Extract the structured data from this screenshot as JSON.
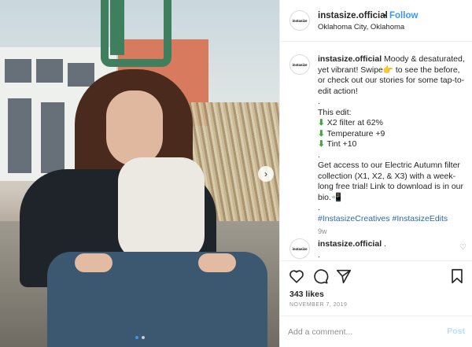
{
  "post": {
    "avatar_text": "instasize",
    "username": "instasize.official",
    "separator": "•",
    "follow_label": "Follow",
    "location": "Oklahoma City, Oklahoma"
  },
  "caption": {
    "username": "instasize.official",
    "text_1": " Moody & desaturated, yet vibrant! Swipe",
    "swipe_emoji": "👉",
    "text_2": " to see the before, or check out our stories for some tap-to-edit action!",
    "dot_1": ".",
    "edit_heading": "This edit:",
    "arrow_icon": "⬇",
    "line_filter": "X2 filter at 62%",
    "line_temp": "Temperature +9",
    "line_tint": "Tint +10",
    "dot_2": ".",
    "access_text": "Get access to our Electric Autumn filter collection (X1, X2, & X3) with a week-long free trial! Link to download is in our bio.",
    "phone_emoji": "📲",
    "dot_3": ".",
    "hashtags": "#InstasizeCreatives #InstasizeEdits",
    "time_ago": "9w"
  },
  "second_comment": {
    "username": "instasize.official",
    "text": ".",
    "dot": ".",
    "heart_icon": "♡"
  },
  "actions": {
    "icons": [
      "heart-icon",
      "comment-icon",
      "share-icon",
      "bookmark-icon"
    ]
  },
  "likes_text": "343 likes",
  "date_text": "NOVEMBER 7, 2019",
  "add_comment": {
    "placeholder": "Add a comment...",
    "post_label": "Post"
  },
  "carousel": {
    "next_icon": "›",
    "active_dot": 0,
    "dot_count": 2
  },
  "colors": {
    "link_blue": "#3897f0",
    "post_disabled": "#b2dffc",
    "muted": "#8e8e8e",
    "text": "#262626"
  }
}
